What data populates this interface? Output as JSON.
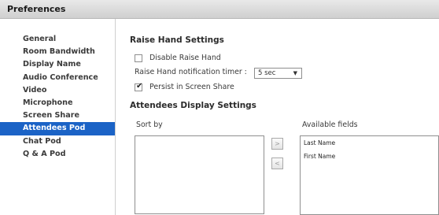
{
  "window": {
    "title": "Preferences"
  },
  "sidebar": {
    "items": [
      {
        "label": "General"
      },
      {
        "label": "Room Bandwidth"
      },
      {
        "label": "Display Name"
      },
      {
        "label": "Audio Conference"
      },
      {
        "label": "Video"
      },
      {
        "label": "Microphone"
      },
      {
        "label": "Screen Share"
      },
      {
        "label": "Attendees Pod",
        "selected": true
      },
      {
        "label": "Chat Pod"
      },
      {
        "label": "Q & A Pod"
      }
    ]
  },
  "raise_hand": {
    "title": "Raise Hand Settings",
    "disable_label": "Disable Raise Hand",
    "disable_checked": false,
    "timer_label": "Raise Hand notification timer :",
    "timer_value": "5 sec",
    "persist_label": "Persist in Screen Share",
    "persist_checked": true
  },
  "attendees_display": {
    "title": "Attendees Display Settings",
    "sort_by_label": "Sort by",
    "available_fields_label": "Available fields",
    "sort_by_items": [],
    "available_fields": [
      "Last Name",
      "First Name"
    ],
    "add_button": ">",
    "remove_button": "<"
  },
  "colors": {
    "selected_bg": "#1b63c6",
    "selected_text": "#ffffff"
  }
}
